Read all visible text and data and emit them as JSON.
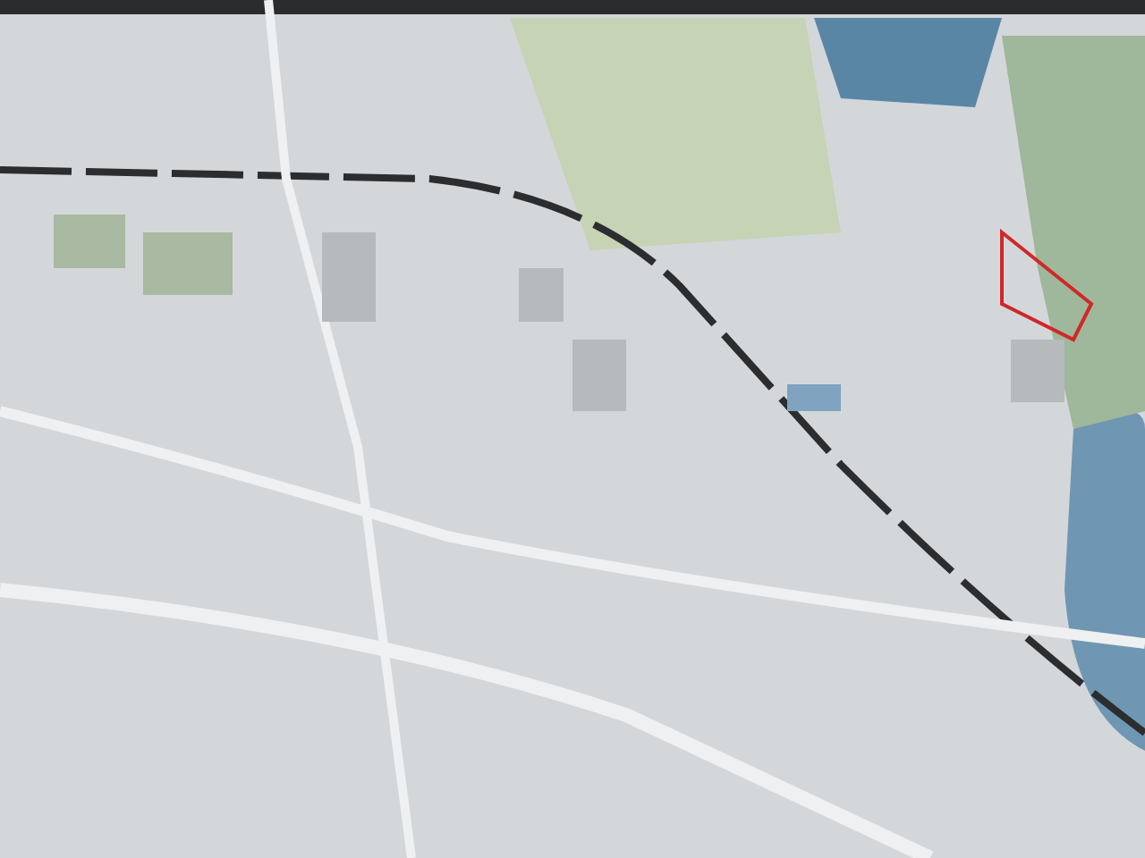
{
  "photo": {
    "kind": "map"
  }
}
